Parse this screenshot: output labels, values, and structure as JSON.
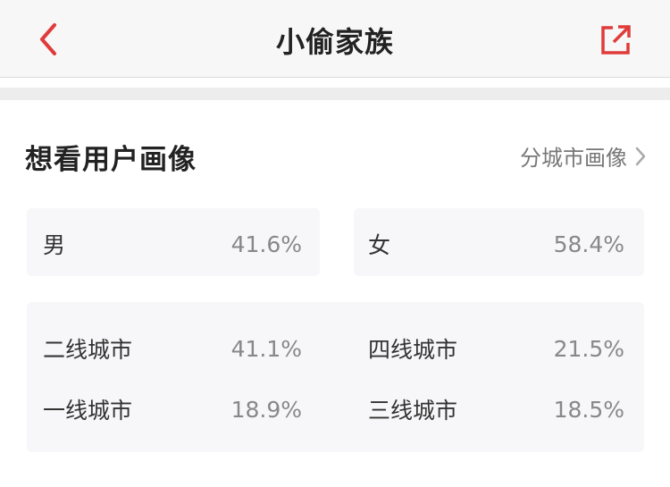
{
  "nav": {
    "title": "小偷家族",
    "back_icon": "chevron-left-icon",
    "share_icon": "share-external-icon",
    "accent_color": "#e03b3b"
  },
  "section": {
    "title": "想看用户画像",
    "city_link_label": "分城市画像",
    "city_link_icon": "chevron-right-icon"
  },
  "gender": [
    {
      "label": "男",
      "value": "41.6%"
    },
    {
      "label": "女",
      "value": "58.4%"
    }
  ],
  "cities": [
    {
      "label": "二线城市",
      "value": "41.1%"
    },
    {
      "label": "四线城市",
      "value": "21.5%"
    },
    {
      "label": "一线城市",
      "value": "18.9%"
    },
    {
      "label": "三线城市",
      "value": "18.5%"
    }
  ]
}
